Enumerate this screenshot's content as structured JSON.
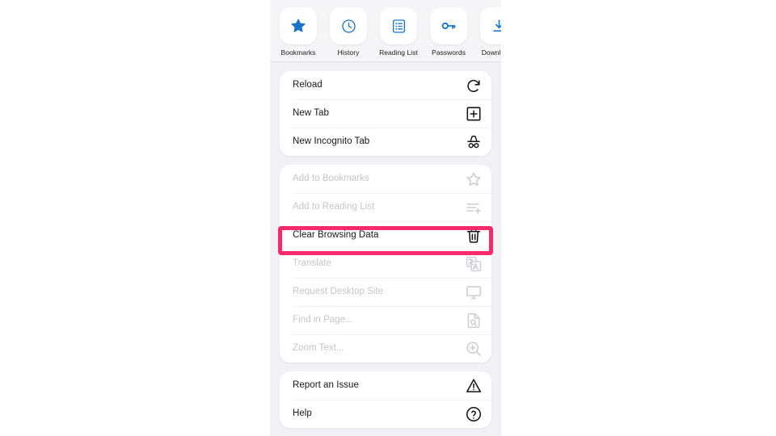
{
  "panel": {
    "name": "browser-menu-panel",
    "background_color": "#f1f1f5",
    "highlight_color": "#f42a6b"
  },
  "shortcut_bar": {
    "accent_color": "#1a73c8",
    "items": [
      {
        "label": "Bookmarks",
        "icon": "star-icon"
      },
      {
        "label": "History",
        "icon": "clock-icon"
      },
      {
        "label": "Reading List",
        "icon": "reading-list-icon"
      },
      {
        "label": "Passwords",
        "icon": "key-icon"
      },
      {
        "label": "Downloads",
        "icon": "download-icon"
      }
    ]
  },
  "menu": {
    "groups": [
      {
        "name": "navigation-group",
        "rows": [
          {
            "label": "Reload",
            "icon": "reload-icon",
            "disabled": false,
            "highlighted": false
          },
          {
            "label": "New Tab",
            "icon": "new-tab-icon",
            "disabled": false,
            "highlighted": false
          },
          {
            "label": "New Incognito Tab",
            "icon": "incognito-icon",
            "disabled": false,
            "highlighted": false
          }
        ]
      },
      {
        "name": "page-actions-group",
        "rows": [
          {
            "label": "Add to Bookmarks",
            "icon": "star-outline-icon",
            "disabled": true,
            "highlighted": false
          },
          {
            "label": "Add to Reading List",
            "icon": "add-to-list-icon",
            "disabled": true,
            "highlighted": false
          },
          {
            "label": "Clear Browsing Data",
            "icon": "trash-icon",
            "disabled": false,
            "highlighted": true
          },
          {
            "label": "Translate",
            "icon": "translate-icon",
            "disabled": true,
            "highlighted": false
          },
          {
            "label": "Request Desktop Site",
            "icon": "desktop-icon",
            "disabled": true,
            "highlighted": false
          },
          {
            "label": "Find in Page...",
            "icon": "find-in-page-icon",
            "disabled": true,
            "highlighted": false
          },
          {
            "label": "Zoom Text...",
            "icon": "zoom-text-icon",
            "disabled": true,
            "highlighted": false
          }
        ]
      },
      {
        "name": "support-group",
        "rows": [
          {
            "label": "Report an Issue",
            "icon": "warning-icon",
            "disabled": false,
            "highlighted": false
          },
          {
            "label": "Help",
            "icon": "help-icon",
            "disabled": false,
            "highlighted": false
          }
        ]
      }
    ]
  }
}
